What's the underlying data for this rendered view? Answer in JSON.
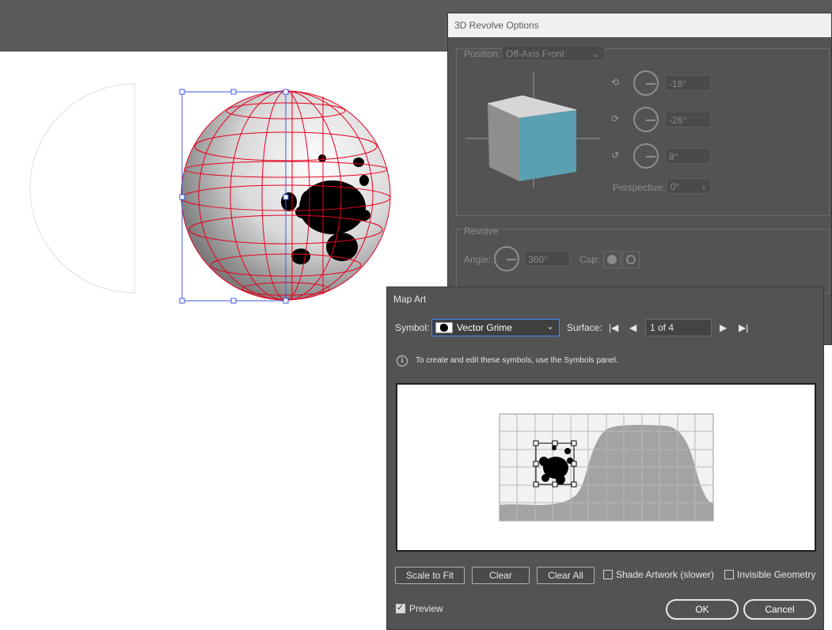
{
  "revolve": {
    "title": "3D Revolve Options",
    "position_label": "Position:",
    "position_value": "Off-Axis Front",
    "x_rotation": "-18°",
    "y_rotation": "-26°",
    "z_rotation": "8°",
    "perspective_label": "Perspective:",
    "perspective_value": "0°",
    "revolve_section": "Revolve",
    "angle_label": "Angle:",
    "angle_value": "360°",
    "cap_label": "Cap:"
  },
  "mapart": {
    "title": "Map Art",
    "symbol_label": "Symbol:",
    "symbol_value": "Vector Grime",
    "surface_label": "Surface:",
    "surface_value": "1 of 4",
    "info_text": "To create and edit these symbols, use the Symbols panel.",
    "scale_to_fit": "Scale to Fit",
    "clear": "Clear",
    "clear_all": "Clear All",
    "shade_artwork": "Shade Artwork (slower)",
    "shade_artwork_checked": false,
    "invisible_geometry": "Invisible Geometry",
    "invisible_geometry_checked": false,
    "preview": "Preview",
    "preview_checked": true,
    "ok": "OK",
    "cancel": "Cancel"
  },
  "colors": {
    "cube_front": "#5a9fb2",
    "wireframe": "#e8001e",
    "selection": "#3b5bdb"
  }
}
